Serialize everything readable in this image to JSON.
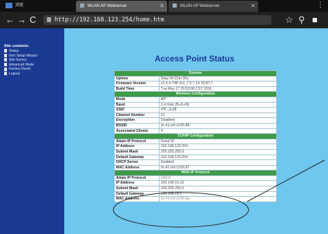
{
  "browser": {
    "home_tab_label": "浏览",
    "tabs": [
      {
        "title": "WLAN AP Webserver",
        "active": true
      },
      {
        "title": "WLAN AP Webserver",
        "active": false
      }
    ],
    "url": "http://192.168.123.254/home.htm"
  },
  "sidebar": {
    "title": "Site contents:",
    "items": [
      "Status",
      "Fimi Setup Wizard",
      "Site Survey",
      "Advanced Mode",
      "Factory Reset",
      "Logout"
    ]
  },
  "page": {
    "title": "Access Point Status",
    "sections": [
      {
        "header": "System",
        "rows": [
          {
            "key": "Uptime",
            "value": "0day:0h:22m:30s"
          },
          {
            "key": "Firmware Version",
            "value": "v2.4.4-T4P-9.0_7.3.7.14.78.B7.7"
          },
          {
            "key": "Build Time",
            "value": "Tue May 17 20:53:00 CST 2016"
          }
        ]
      },
      {
        "header": "Wireless Configuration",
        "rows": [
          {
            "key": "Mode",
            "value": "AP"
          },
          {
            "key": "Band",
            "value": "2.4 GHz (B+G+N)"
          },
          {
            "key": "SSID",
            "value": "IPP_3c38"
          },
          {
            "key": "Channel Number",
            "value": "11"
          },
          {
            "key": "Encryption",
            "value": "Disabled"
          },
          {
            "key": "BSSID",
            "value": "0c:41:e9:c3:05:88"
          },
          {
            "key": "Associated Clients",
            "value": "0"
          }
        ]
      },
      {
        "header": "TCP/IP Configuration",
        "rows": [
          {
            "key": "Attain IP Protocol",
            "value": "Fixed IP"
          },
          {
            "key": "IP Address",
            "value": "192.168.123.254"
          },
          {
            "key": "Subnet Mask",
            "value": "255.255.255.0"
          },
          {
            "key": "Default Gateway",
            "value": "192.168.123.254"
          },
          {
            "key": "DHCP Server",
            "value": "Enabled"
          },
          {
            "key": "MAC Address",
            "value": "0c:41:e9:c3:05:87"
          }
        ]
      },
      {
        "header": "WAN IP Protocol",
        "rows": [
          {
            "key": "Attain IP Protocol",
            "value": "DHCP"
          },
          {
            "key": "IP Address",
            "value": "192.168.15.19"
          },
          {
            "key": "Subnet Mask",
            "value": "255.255.255.0"
          },
          {
            "key": "Default Gateway",
            "value": "192.168.15.1"
          },
          {
            "key": "MAC Address",
            "value": "0c:41:e9:c3:05:8a"
          }
        ]
      }
    ]
  },
  "colors": {
    "page_background": "#6fc6ee",
    "sidebar": "#1a3a92",
    "section_header": "#3f9a47",
    "title": "#1a3a92"
  },
  "annotation": "ellipse with pointer line highlighting the WAN IP Address, Subnet Mask and Default Gateway rows"
}
